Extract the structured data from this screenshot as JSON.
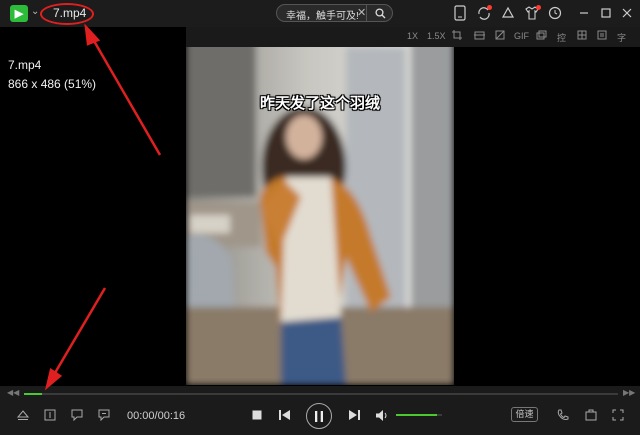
{
  "window": {
    "title": "7.mp4",
    "logo_glyph": "▶",
    "caret_glyph": "⌄"
  },
  "search": {
    "text": "幸福，触手可及!",
    "clear_glyph": "✕"
  },
  "toolbar2": {
    "speed_1x": "1X",
    "speed_15x": "1.5X",
    "gif_label": "GIF",
    "control_label": "控",
    "caption_label": "字"
  },
  "video": {
    "caption": "昨天发了这个羽绒"
  },
  "file_info": {
    "name": "7.mp4",
    "resolution": "866 x 486 (51%)"
  },
  "playback": {
    "time": "00:00/00:16",
    "progress_fraction": 0.03,
    "volume_fraction": 0.9,
    "speed_button": "倍速"
  },
  "colors": {
    "accent_green": "#4cc830",
    "logo_green": "#2dbb3a",
    "annotation_red": "#e02020",
    "notify_red": "#ff3b30"
  }
}
